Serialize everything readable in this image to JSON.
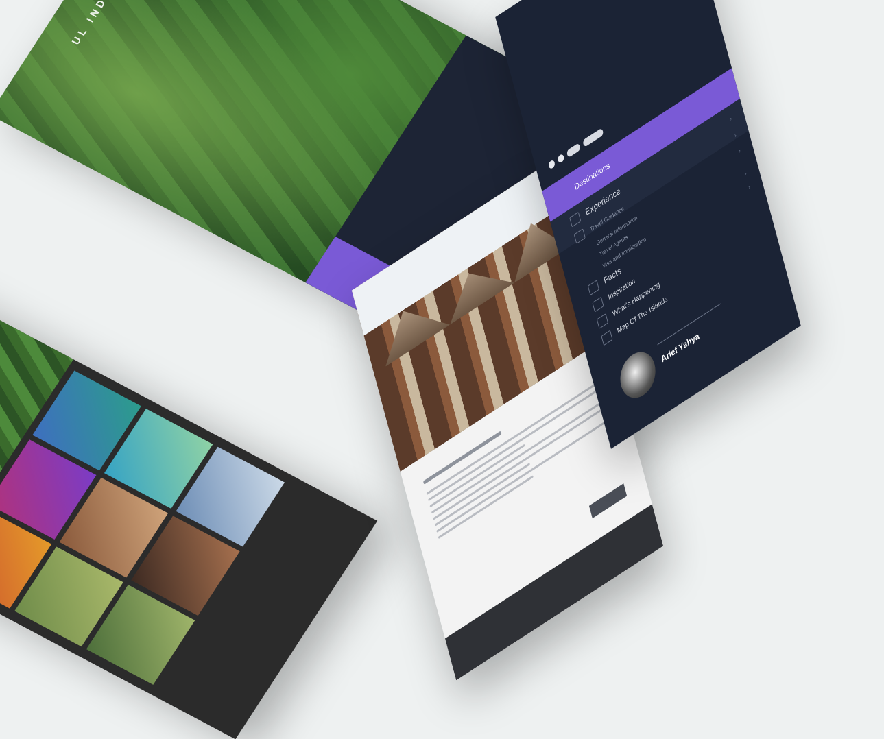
{
  "hero": {
    "title": "UL INDONESIA"
  },
  "navigation": {
    "user_name": "Arief Yahya",
    "items": [
      {
        "label": "Destinations",
        "active": true
      },
      {
        "label": "Experience"
      },
      {
        "label": "Travel Guidance"
      },
      {
        "label": "General Information",
        "sub": true
      },
      {
        "label": "Travel Agents",
        "sub": true
      },
      {
        "label": "Visa and Immigration",
        "sub": true
      },
      {
        "label": "Facts"
      },
      {
        "label": "Inspiration"
      },
      {
        "label": "What's Happening"
      },
      {
        "label": "Map Of The Islands"
      }
    ]
  },
  "colors": {
    "accent": "#7a5ad6",
    "navy": "#1b2335"
  }
}
